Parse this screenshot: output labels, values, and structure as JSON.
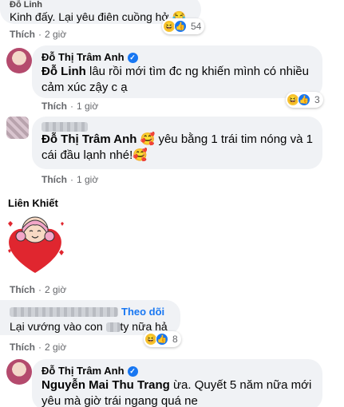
{
  "c1": {
    "author": "Đỗ Linh",
    "text": "Kinh đấy. Lại yêu điên cuồng hở 😂",
    "like": "Thích",
    "time": "2 giờ",
    "count": "54"
  },
  "c2": {
    "author": "Đỗ Thị Trâm Anh",
    "mention": "Đỗ Linh",
    "text": " lâu rồi mới tìm đc ng khiến mình có nhiều cảm xúc zậy c ạ",
    "like": "Thích",
    "time": "1 giờ",
    "count": "3"
  },
  "c3": {
    "mention": "Đỗ Thị Trâm Anh",
    "text": " 🥰 yêu bằng 1 trái tim nóng và 1 cái đầu lạnh nhé!🥰",
    "like": "Thích",
    "time": "1 giờ"
  },
  "c4": {
    "author": "Liên Khiết",
    "like": "Thích",
    "time": "2 giờ"
  },
  "c5": {
    "follow": "Theo dõi",
    "text_before": "Lại vướng vào con ",
    "text_after": "ty nữa hả",
    "like": "Thích",
    "time": "2 giờ",
    "count": "8"
  },
  "c6": {
    "author": "Đỗ Thị Trâm Anh",
    "mention": "Nguyễn Mai Thu Trang",
    "text": " ừa. Quyết 5 năm nữa mới yêu mà giờ trái ngang quá ne"
  },
  "sep": "·",
  "colors": {
    "bubble": "#f0f2f5",
    "link": "#1877f2",
    "meta": "#65676b"
  },
  "icons": [
    "verified-badge-icon",
    "haha-reaction-icon",
    "like-reaction-icon",
    "heart-sticker"
  ]
}
